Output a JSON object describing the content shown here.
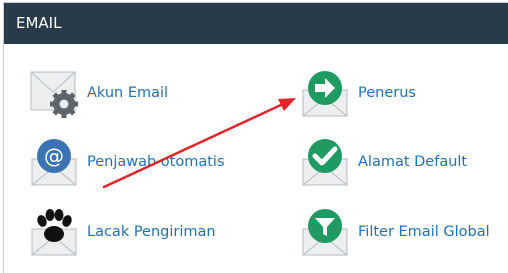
{
  "section": {
    "title": "EMAIL"
  },
  "items": [
    {
      "label": "Akun Email",
      "icon": "envelope-gear-icon"
    },
    {
      "label": "Penerus",
      "icon": "forward-arrow-envelope-icon"
    },
    {
      "label": "Penjawab otomatis",
      "icon": "at-sign-envelope-icon"
    },
    {
      "label": "Alamat Default",
      "icon": "checkmark-envelope-icon"
    },
    {
      "label": "Lacak Pengiriman",
      "icon": "paw-print-envelope-icon"
    },
    {
      "label": "Filter Email Global",
      "icon": "funnel-filter-envelope-icon"
    }
  ],
  "annotation": {
    "color": "#e0262b"
  },
  "colors": {
    "header_bg": "#293a4a",
    "link": "#1f72b8",
    "blue_badge": "#3b73b5",
    "green_badge": "#1f9a63"
  }
}
